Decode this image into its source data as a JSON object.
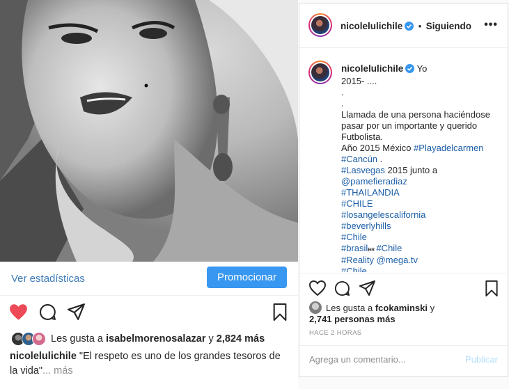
{
  "post": {
    "stats_link": "Ver estadísticas",
    "promote_button": "Promocionar",
    "likes": {
      "prefix": "Les gusta a",
      "user": "isabelmorenosalazar",
      "connector": "y",
      "count": "2,824 más"
    },
    "caption": {
      "user": "nicolelulichile",
      "text": "\"El respeto es uno de los grandes tesoros de la vida\"",
      "more": "... más"
    }
  },
  "panel": {
    "header": {
      "username": "nicolelulichile",
      "separator": "•",
      "follow_status": "Siguiendo",
      "options": "•••"
    },
    "comment": {
      "username": "nicolelulichile",
      "first_word": "Yo",
      "lines": [
        "2015- ....",
        ".",
        ".",
        "Llamada de una persona haciéndose",
        "pasar por un importante y querido",
        "Futbolista."
      ],
      "line_year_prefix": "Año 2015 México ",
      "tag_playa": "#Playadelcarmen",
      "tag_cancun": "#Cancún",
      "cancun_suffix": " .",
      "tag_lasvegas": "#Lasvegas",
      "lasvegas_suffix": " 2015 junto a",
      "mention_pame": "@pamefieradiaz",
      "tag_thailandia": "#THAILANDIA",
      "tag_chile_caps": "#CHILE",
      "tag_losangeles": "#losangelescalifornia",
      "tag_beverlyhills": "#beverlyhills",
      "tag_chile": "#Chile",
      "tag_brasil": "#brasil",
      "brasil_suffix": "ᴃʀ ",
      "tag_chile2": "#Chile",
      "tag_reality": "#Reality",
      "mention_mega": "@mega.tv",
      "tag_chile3": "#Chile"
    },
    "likes": {
      "prefix": "Les gusta a",
      "user": "fcokaminski",
      "connector": "y",
      "count": "2,741 personas más"
    },
    "time": "HACE 2 HORAS",
    "comment_placeholder": "Agrega un comentario...",
    "post_button": "Publicar"
  },
  "colors": {
    "accent": "#3897f0",
    "like_red": "#ed4956",
    "link_blue": "#1c5fa8",
    "post_disabled": "#b2dffc",
    "verified": "#3897f0"
  },
  "icons": {
    "like": "heart-icon",
    "comment": "comment-icon",
    "share": "send-icon",
    "save": "bookmark-icon",
    "verified": "verified-badge-icon",
    "options": "more-options-icon"
  }
}
